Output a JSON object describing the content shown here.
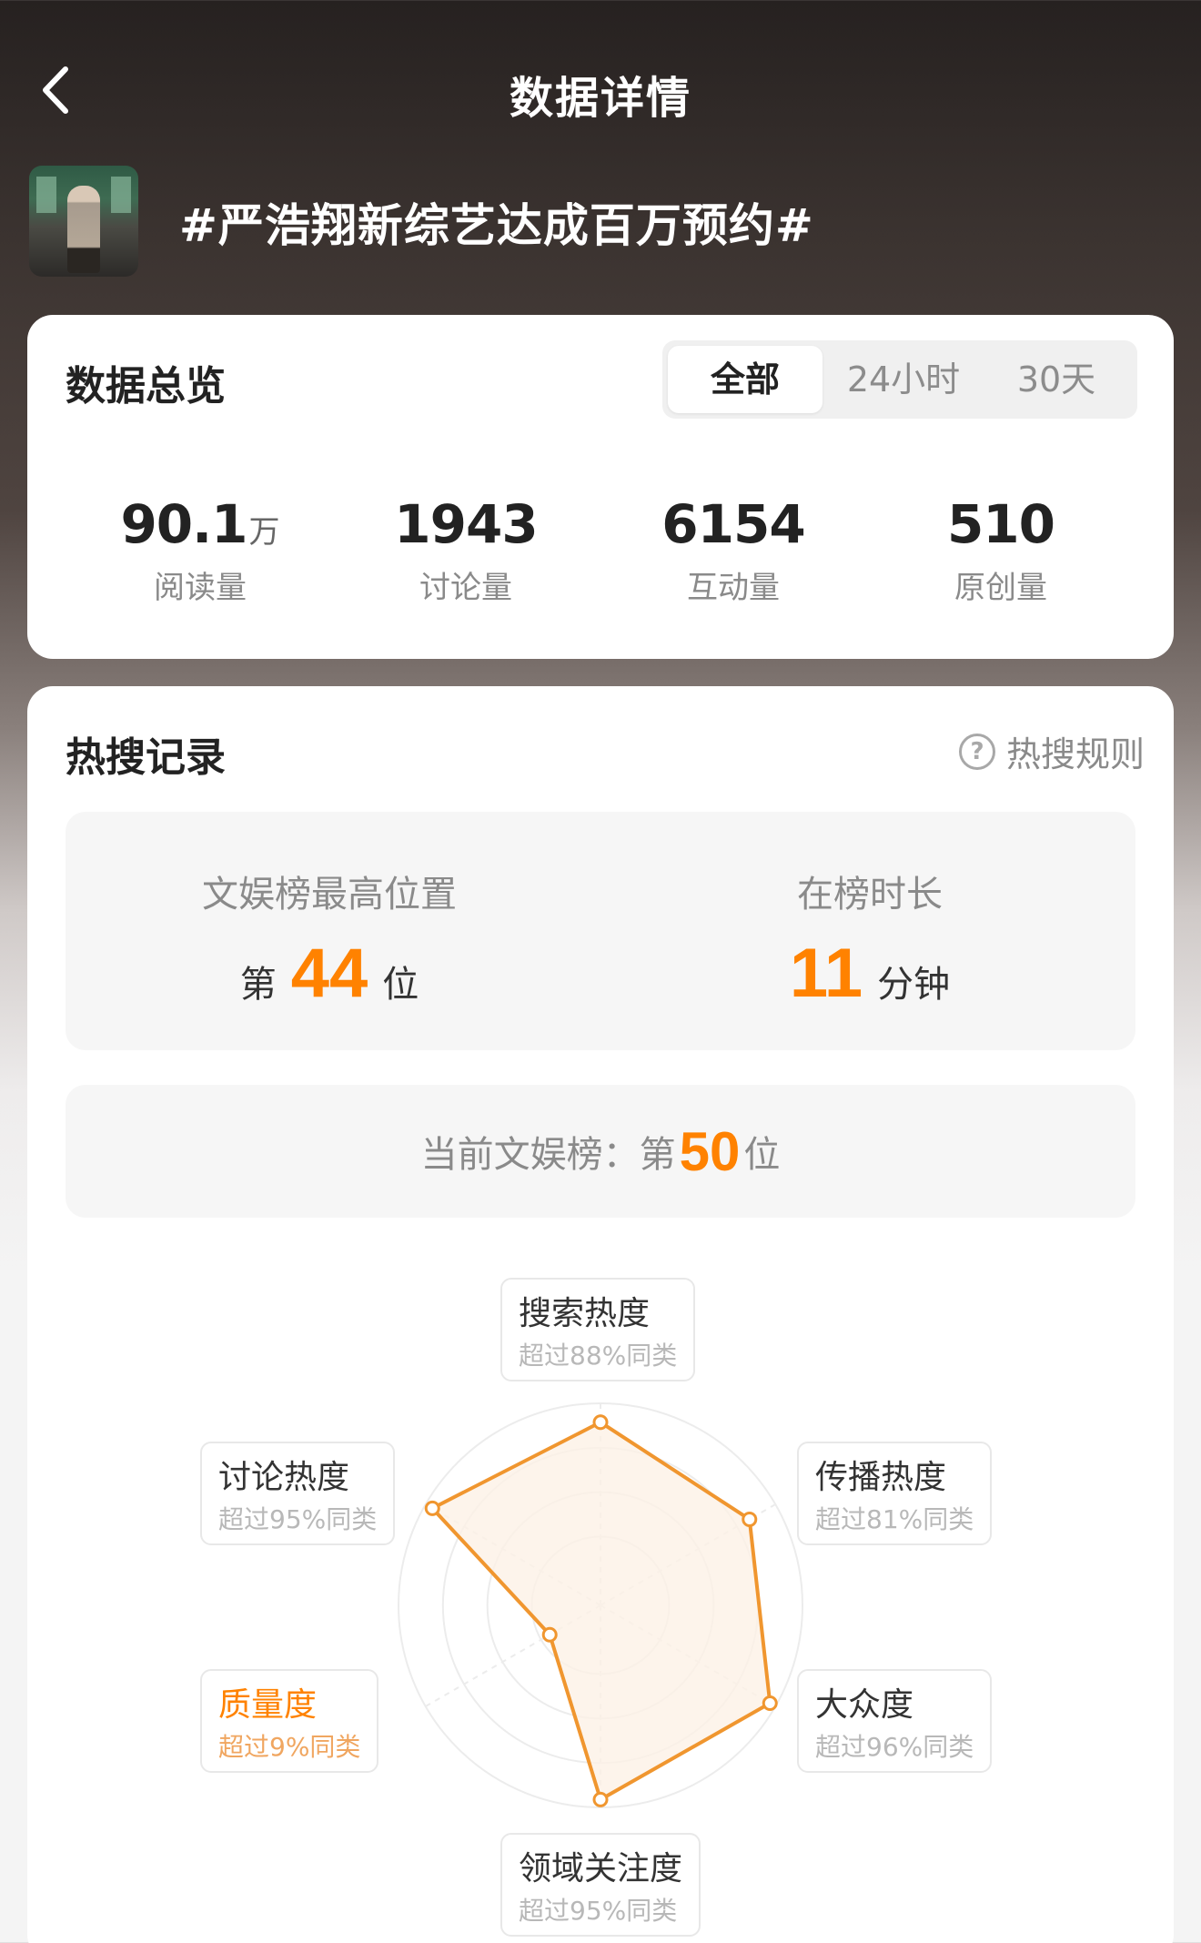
{
  "header": {
    "title": "数据详情"
  },
  "topic": {
    "title": "#严浩翔新综艺达成百万预约#"
  },
  "overview": {
    "title": "数据总览",
    "tabs": [
      {
        "label": "全部",
        "active": true
      },
      {
        "label": "24小时",
        "active": false
      },
      {
        "label": "30天",
        "active": false
      }
    ],
    "stats": [
      {
        "value": "90.1",
        "unit": "万",
        "label": "阅读量"
      },
      {
        "value": "1943",
        "unit": "",
        "label": "讨论量"
      },
      {
        "value": "6154",
        "unit": "",
        "label": "互动量"
      },
      {
        "value": "510",
        "unit": "",
        "label": "原创量"
      }
    ]
  },
  "hot": {
    "title": "热搜记录",
    "rule_label": "热搜规则",
    "best": {
      "label": "文娱榜最高位置",
      "prefix": "第",
      "value": "44",
      "suffix": "位"
    },
    "duration": {
      "label": "在榜时长",
      "value": "11",
      "suffix": "分钟"
    },
    "current": {
      "label": "当前文娱榜：第",
      "value": "50",
      "suffix": "位"
    }
  },
  "radar": {
    "dimensions": [
      {
        "name": "搜索热度",
        "desc": "超过88%同类",
        "value": 88
      },
      {
        "name": "传播热度",
        "desc": "超过81%同类",
        "value": 81
      },
      {
        "name": "大众度",
        "desc": "超过96%同类",
        "value": 96
      },
      {
        "name": "领域关注度",
        "desc": "超过95%同类",
        "value": 95
      },
      {
        "name": "质量度",
        "desc": "超过9%同类",
        "value": 9,
        "highlight": true
      },
      {
        "name": "讨论热度",
        "desc": "超过95%同类",
        "value": 95
      }
    ],
    "colors": {
      "line": "#f0962f",
      "fill": "#fdf1e6",
      "ring": "#ececec"
    }
  }
}
